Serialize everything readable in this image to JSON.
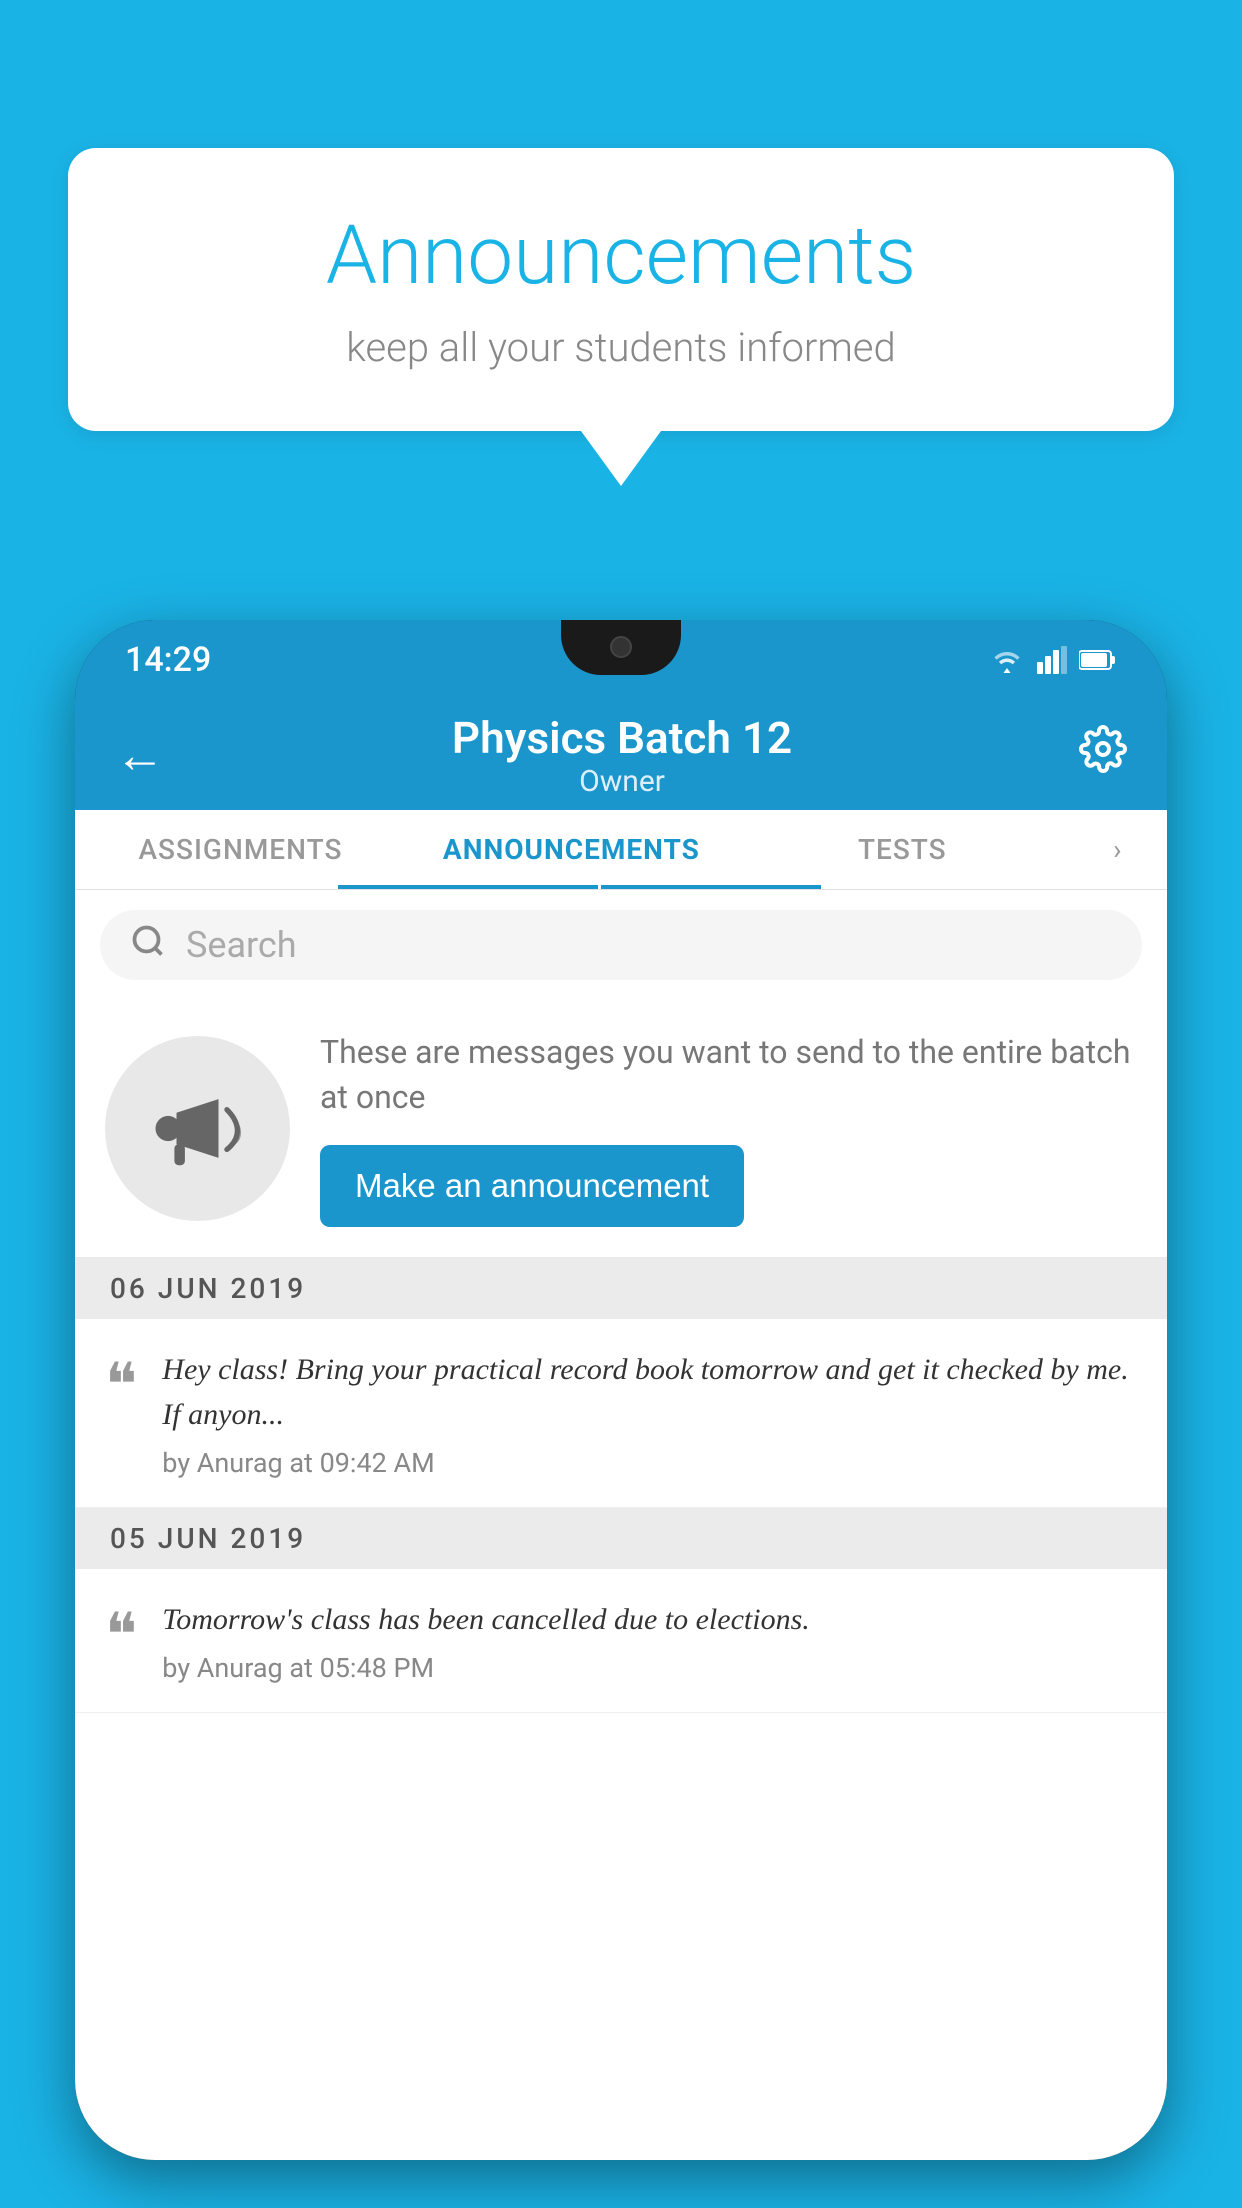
{
  "background_color": "#1ab3e6",
  "speech_bubble": {
    "title": "Announcements",
    "subtitle": "keep all your students informed"
  },
  "phone": {
    "status_bar": {
      "time": "14:29",
      "icons": [
        "wifi",
        "signal",
        "battery"
      ]
    },
    "header": {
      "back_label": "←",
      "title": "Physics Batch 12",
      "subtitle": "Owner",
      "settings_label": "⚙"
    },
    "tabs": [
      {
        "label": "ASSIGNMENTS",
        "active": false
      },
      {
        "label": "ANNOUNCEMENTS",
        "active": true
      },
      {
        "label": "TESTS",
        "active": false
      },
      {
        "label": "›",
        "active": false
      }
    ],
    "search": {
      "placeholder": "Search"
    },
    "promo": {
      "icon": "📣",
      "description": "These are messages you want to send to the entire batch at once",
      "button_label": "Make an announcement"
    },
    "announcements": [
      {
        "date": "06  JUN  2019",
        "text": "Hey class! Bring your practical record book tomorrow and get it checked by me. If anyon...",
        "author": "by Anurag at 09:42 AM"
      },
      {
        "date": "05  JUN  2019",
        "text": "Tomorrow's class has been cancelled due to elections.",
        "author": "by Anurag at 05:48 PM"
      }
    ]
  }
}
